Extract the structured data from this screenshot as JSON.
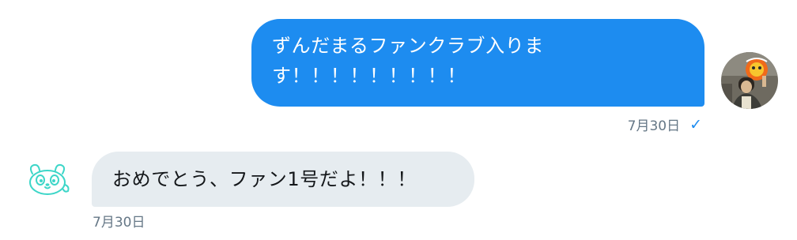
{
  "conversation": {
    "outgoing": {
      "lines": [
        "ずんだまるファンクラブ入りま",
        "す！！！！！！！！！"
      ],
      "timestamp": "7月30日",
      "read_receipt": "✓",
      "avatar_icon": "user-avatar-photo",
      "bubble_color": "#1d8cf0"
    },
    "incoming": {
      "text": "おめでとう、ファン1号だよ！！！",
      "timestamp": "7月30日",
      "avatar_icon": "panda-avatar",
      "bubble_color": "#e6ecf0"
    },
    "meta_color": "#657786"
  }
}
